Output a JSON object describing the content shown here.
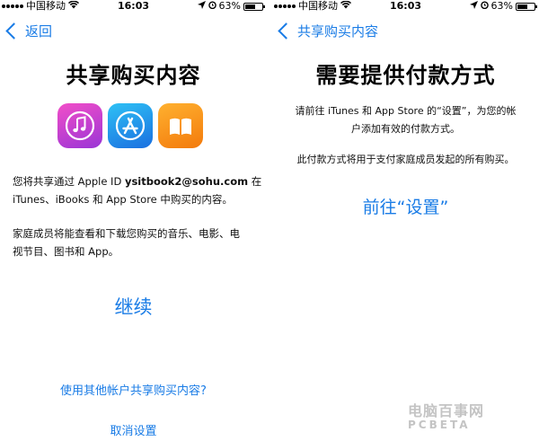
{
  "status_left": {
    "carrier": "中国移动",
    "time": "16:03",
    "battery": "63%",
    "battery_level": 0.63
  },
  "status_right": {
    "carrier": "中国移动",
    "time": "16:03",
    "battery": "63%",
    "battery_level": 0.63
  },
  "left": {
    "back_label": "返回",
    "title": "共享购买内容",
    "app_icons": [
      "music-icon",
      "app-store-icon",
      "books-icon"
    ],
    "para1_line1_prefix": "您将共享通过 Apple ID ",
    "apple_id": "ysitbook2@sohu.com",
    "para1_line1_suffix": " 在",
    "para1_line2": "iTunes、iBooks 和 App Store 中购买的内容。",
    "para2_line1": "家庭成员将能查看和下载您购买的音乐、电影、电",
    "para2_line2": "视节目、图书和 App。",
    "continue_label": "继续",
    "other_account_label": "使用其他帐户共享购买内容?",
    "cancel_label": "取消设置"
  },
  "right": {
    "back_label": "共享购买内容",
    "title": "需要提供付款方式",
    "para1_line1": "请前往 iTunes 和 App Store 的“设置”，为您的帐",
    "para1_line2": "户添加有效的付款方式。",
    "para2": "此付款方式将用于支付家庭成员发起的所有购买。",
    "goto_settings_label": "前往“设置”"
  },
  "watermark": {
    "text": "电脑百事网",
    "sub": "PCBETA"
  },
  "colors": {
    "link_blue": "#1a7ce6",
    "background": "#ffffff"
  }
}
